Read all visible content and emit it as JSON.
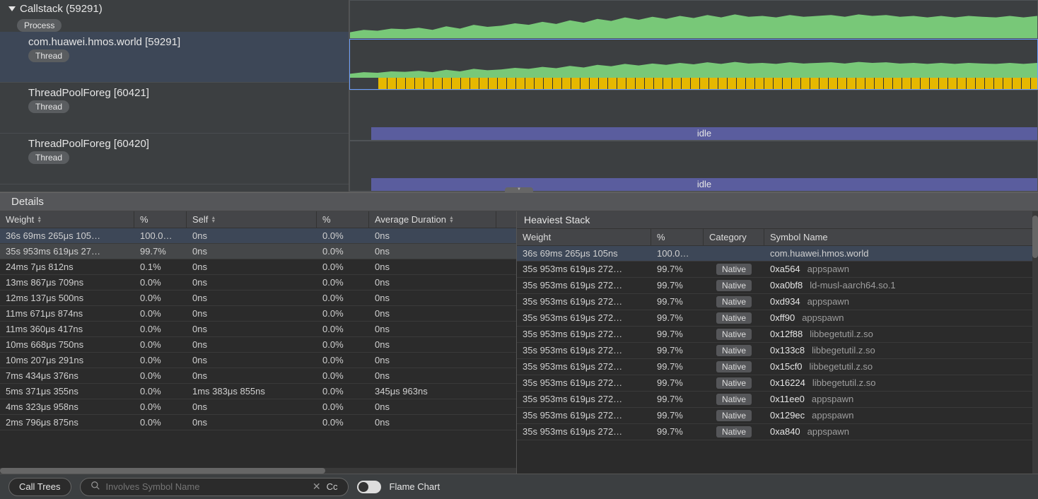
{
  "callstack": {
    "title": "Callstack (59291)",
    "process_badge": "Process"
  },
  "threads": [
    {
      "title": "com.huawei.hmos.world [59291]",
      "badge": "Thread",
      "selected": true,
      "kind": "flame"
    },
    {
      "title": "ThreadPoolForeg [60421]",
      "badge": "Thread",
      "selected": false,
      "kind": "idle",
      "idle_label": "idle"
    },
    {
      "title": "ThreadPoolForeg [60420]",
      "badge": "Thread",
      "selected": false,
      "kind": "idle",
      "idle_label": "idle"
    }
  ],
  "details_label": "Details",
  "left_table": {
    "columns": [
      "Weight",
      "%",
      "Self",
      "%",
      "Average Duration"
    ],
    "rows": [
      {
        "w": "36s 69ms 265μs 105…",
        "wp": "100.0…",
        "s": "0ns",
        "sp": "0.0%",
        "ad": "0ns",
        "sel": true
      },
      {
        "w": "35s 953ms 619μs 27…",
        "wp": "99.7%",
        "s": "0ns",
        "sp": "0.0%",
        "ad": "0ns",
        "hov": true
      },
      {
        "w": "24ms 7μs 812ns",
        "wp": "0.1%",
        "s": "0ns",
        "sp": "0.0%",
        "ad": "0ns"
      },
      {
        "w": "13ms 867μs 709ns",
        "wp": "0.0%",
        "s": "0ns",
        "sp": "0.0%",
        "ad": "0ns"
      },
      {
        "w": "12ms 137μs 500ns",
        "wp": "0.0%",
        "s": "0ns",
        "sp": "0.0%",
        "ad": "0ns"
      },
      {
        "w": "11ms 671μs 874ns",
        "wp": "0.0%",
        "s": "0ns",
        "sp": "0.0%",
        "ad": "0ns"
      },
      {
        "w": "11ms 360μs 417ns",
        "wp": "0.0%",
        "s": "0ns",
        "sp": "0.0%",
        "ad": "0ns"
      },
      {
        "w": "10ms 668μs 750ns",
        "wp": "0.0%",
        "s": "0ns",
        "sp": "0.0%",
        "ad": "0ns"
      },
      {
        "w": "10ms 207μs 291ns",
        "wp": "0.0%",
        "s": "0ns",
        "sp": "0.0%",
        "ad": "0ns"
      },
      {
        "w": "7ms 434μs 376ns",
        "wp": "0.0%",
        "s": "0ns",
        "sp": "0.0%",
        "ad": "0ns"
      },
      {
        "w": "5ms 371μs 355ns",
        "wp": "0.0%",
        "s": "1ms 383μs 855ns",
        "sp": "0.0%",
        "ad": "345μs 963ns"
      },
      {
        "w": "4ms 323μs 958ns",
        "wp": "0.0%",
        "s": "0ns",
        "sp": "0.0%",
        "ad": "0ns"
      },
      {
        "w": "2ms 796μs 875ns",
        "wp": "0.0%",
        "s": "0ns",
        "sp": "0.0%",
        "ad": "0ns"
      }
    ]
  },
  "right_pane": {
    "title": "Heaviest Stack",
    "columns": [
      "Weight",
      "%",
      "Category",
      "Symbol Name"
    ],
    "rows": [
      {
        "w": "36s 69ms 265μs 105ns",
        "wp": "100.0…",
        "cat": "",
        "hex": "",
        "nm": "com.huawei.hmos.world",
        "sel": true
      },
      {
        "w": "35s 953ms 619μs 272…",
        "wp": "99.7%",
        "cat": "Native",
        "hex": "0xa564",
        "nm": "appspawn"
      },
      {
        "w": "35s 953ms 619μs 272…",
        "wp": "99.7%",
        "cat": "Native",
        "hex": "0xa0bf8",
        "nm": "ld-musl-aarch64.so.1"
      },
      {
        "w": "35s 953ms 619μs 272…",
        "wp": "99.7%",
        "cat": "Native",
        "hex": "0xd934",
        "nm": "appspawn"
      },
      {
        "w": "35s 953ms 619μs 272…",
        "wp": "99.7%",
        "cat": "Native",
        "hex": "0xff90",
        "nm": "appspawn"
      },
      {
        "w": "35s 953ms 619μs 272…",
        "wp": "99.7%",
        "cat": "Native",
        "hex": "0x12f88",
        "nm": "libbegetutil.z.so"
      },
      {
        "w": "35s 953ms 619μs 272…",
        "wp": "99.7%",
        "cat": "Native",
        "hex": "0x133c8",
        "nm": "libbegetutil.z.so"
      },
      {
        "w": "35s 953ms 619μs 272…",
        "wp": "99.7%",
        "cat": "Native",
        "hex": "0x15cf0",
        "nm": "libbegetutil.z.so"
      },
      {
        "w": "35s 953ms 619μs 272…",
        "wp": "99.7%",
        "cat": "Native",
        "hex": "0x16224",
        "nm": "libbegetutil.z.so"
      },
      {
        "w": "35s 953ms 619μs 272…",
        "wp": "99.7%",
        "cat": "Native",
        "hex": "0x11ee0",
        "nm": "appspawn"
      },
      {
        "w": "35s 953ms 619μs 272…",
        "wp": "99.7%",
        "cat": "Native",
        "hex": "0x129ec",
        "nm": "appspawn"
      },
      {
        "w": "35s 953ms 619μs 272…",
        "wp": "99.7%",
        "cat": "Native",
        "hex": "0xa840",
        "nm": "appspawn"
      }
    ]
  },
  "footer": {
    "mode": "Call Trees",
    "search_placeholder": "Involves Symbol Name",
    "cc_label": "Cc",
    "flame_chart_label": "Flame Chart"
  }
}
